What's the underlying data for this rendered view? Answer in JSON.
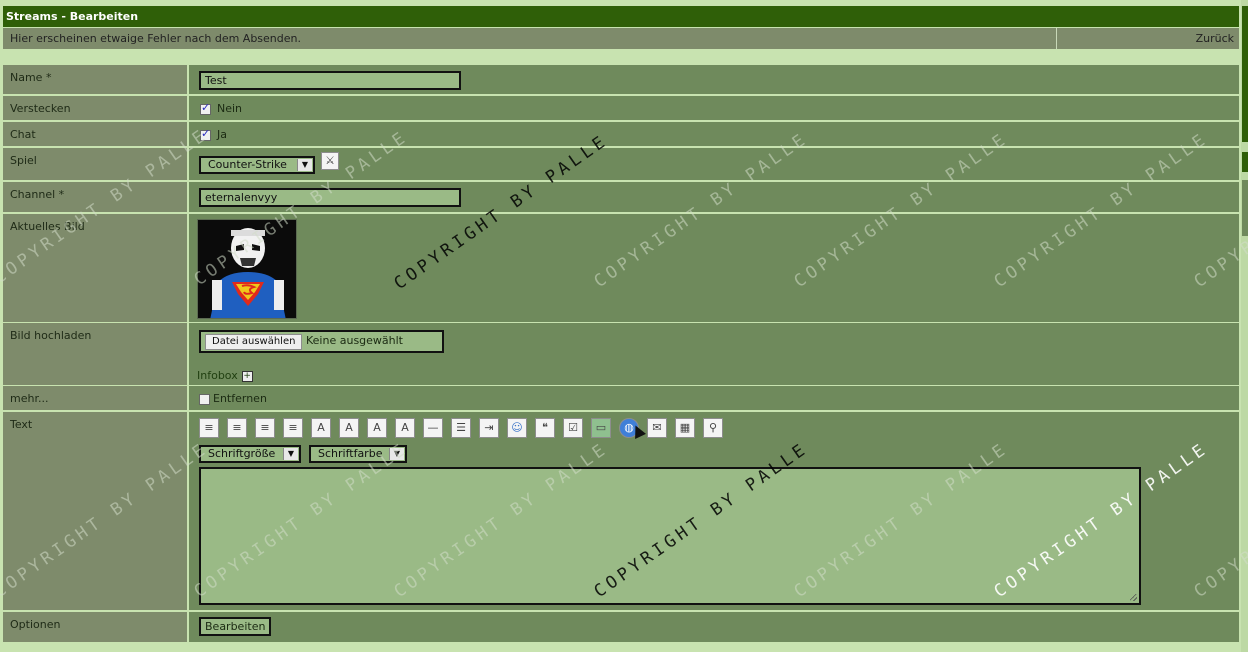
{
  "header": {
    "title": "Streams - Bearbeiten"
  },
  "infobar": {
    "message": "Hier erscheinen etwaige Fehler nach dem Absenden.",
    "back_link": "Zurück"
  },
  "form": {
    "name": {
      "label": "Name *",
      "value": "Test"
    },
    "hide": {
      "label": "Verstecken",
      "checkbox_label": "Nein",
      "checked": true
    },
    "chat": {
      "label": "Chat",
      "checkbox_label": "Ja",
      "checked": true
    },
    "game": {
      "label": "Spiel",
      "selected": "Counter-Strike"
    },
    "channel": {
      "label": "Channel *",
      "value": "eternalenvyy"
    },
    "current_image": {
      "label": "Aktuelles Bild"
    },
    "upload": {
      "label": "Bild hochladen",
      "button": "Datei auswählen",
      "status": "Keine ausgewählt",
      "infobox_link": "Infobox"
    },
    "more": {
      "label": "mehr...",
      "checkbox_label": "Entfernen",
      "checked": false
    },
    "text": {
      "label": "Text",
      "font_size_select": "Schriftgröße",
      "font_color_select": "Schriftfarbe",
      "toolbar_icons": [
        "align-left-icon",
        "align-center-icon",
        "align-right-icon",
        "align-justify-icon",
        "bold-icon",
        "italic-icon",
        "underline-icon",
        "strikethrough-icon",
        "horizontal-rule-icon",
        "list-icon",
        "indent-icon",
        "smiley-icon",
        "quote-icon",
        "checklist-icon",
        "image-icon",
        "globe-link-icon",
        "email-icon",
        "table-icon",
        "search-icon"
      ]
    },
    "options": {
      "label": "Optionen",
      "submit": "Bearbeiten"
    }
  },
  "watermark": {
    "text": "COPYRIGHT BY PALLE"
  },
  "colors": {
    "title_bg": "#2f5f08",
    "label_bg": "#7e8b6b",
    "value_bg": "#6f8a5c",
    "input_bg": "#9aba86",
    "page_bg": "#c8e3b0"
  }
}
